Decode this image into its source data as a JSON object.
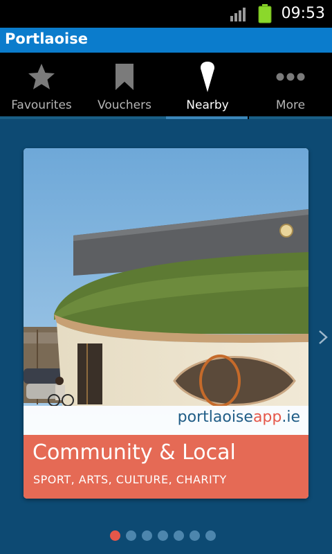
{
  "status_bar": {
    "time": "09:53",
    "signal_icon": "signal-icon",
    "battery_icon": "battery-icon",
    "battery_color": "#8bd82b"
  },
  "app_bar": {
    "title": "Portlaoise",
    "color": "#0b7ccc"
  },
  "tabs": [
    {
      "label": "Favourites",
      "icon": "star-icon",
      "active": false
    },
    {
      "label": "Vouchers",
      "icon": "bookmark-icon",
      "active": false
    },
    {
      "label": "Nearby",
      "icon": "location-pin-icon",
      "active": true
    },
    {
      "label": "More",
      "icon": "more-icon",
      "active": false
    }
  ],
  "carousel": {
    "card": {
      "brand_prefix": "portlaoise",
      "brand_app": "app",
      "brand_suffix": ".ie",
      "category_title": "Community & Local",
      "category_subtitle": "SPORT, ARTS, CULTURE, CHARITY",
      "band_color": "#e56a55"
    },
    "next_icon": "chevron-right-icon",
    "pages": 7,
    "active_page": 1,
    "active_dot_color": "#e5574a"
  },
  "background_color": "#0d4a73"
}
